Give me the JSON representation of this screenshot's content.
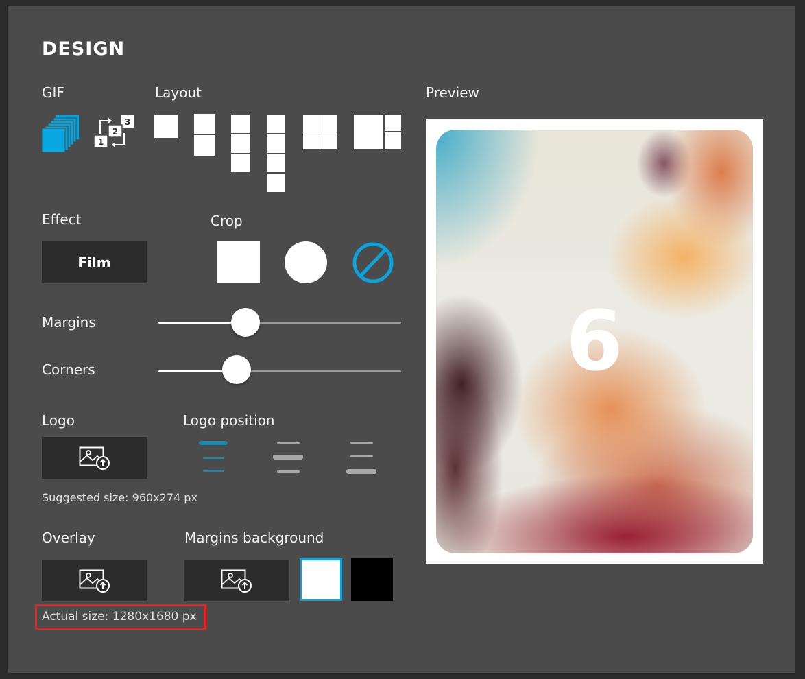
{
  "header": {
    "title": "DESIGN"
  },
  "gif": {
    "label": "GIF",
    "options": [
      {
        "name": "stack",
        "icon": "stacked-frames-icon",
        "selected": true
      },
      {
        "name": "sequence",
        "icon": "sequence-loop-icon",
        "selected": false,
        "numbers": [
          "1",
          "2",
          "3"
        ]
      }
    ]
  },
  "layout": {
    "label": "Layout",
    "options": [
      "1 frame",
      "2 frames vertical",
      "3 frames vertical",
      "4 frames vertical",
      "2x2 grid",
      "1 large + 2 small"
    ]
  },
  "preview": {
    "label": "Preview",
    "frame_number": "6"
  },
  "effect": {
    "label": "Effect",
    "value": "Film"
  },
  "crop": {
    "label": "Crop",
    "options": [
      {
        "name": "square",
        "icon": "square-crop-icon",
        "selected": false
      },
      {
        "name": "circle",
        "icon": "circle-crop-icon",
        "selected": false
      },
      {
        "name": "none",
        "icon": "no-crop-icon",
        "selected": true
      }
    ]
  },
  "margins": {
    "label": "Margins",
    "value_fraction": 0.36
  },
  "corners": {
    "label": "Corners",
    "value_fraction": 0.32
  },
  "logo": {
    "label": "Logo",
    "upload_icon": "image-upload-icon",
    "hint": "Suggested size: 960x274 px"
  },
  "logo_position": {
    "label": "Logo position",
    "options": [
      {
        "name": "top",
        "selected": true
      },
      {
        "name": "middle",
        "selected": false
      },
      {
        "name": "bottom",
        "selected": false
      }
    ]
  },
  "overlay": {
    "label": "Overlay",
    "upload_icon": "image-upload-icon",
    "hint": "Actual size: 1280x1680 px"
  },
  "margins_background": {
    "label": "Margins background",
    "upload_icon": "image-upload-icon",
    "swatches": [
      {
        "name": "white",
        "color": "#ffffff",
        "selected": true
      },
      {
        "name": "black",
        "color": "#000000",
        "selected": false
      }
    ]
  },
  "colors": {
    "accent": "#0aa3dc",
    "panel": "#4b4b4b",
    "button": "#2c2c2c",
    "highlight": "#ff1a1a"
  }
}
